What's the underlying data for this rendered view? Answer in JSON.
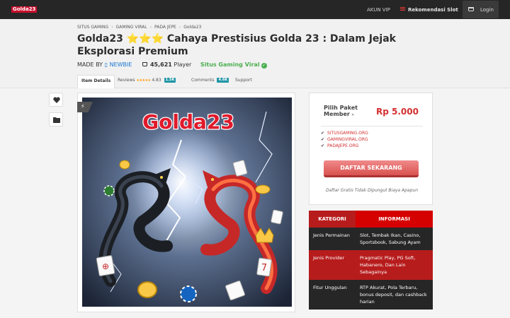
{
  "nav": {
    "logo": "Golda23",
    "akun_vip": "AKUN VIP",
    "rekomendasi": "Rekomendasi Slot",
    "login": "Login"
  },
  "breadcrumb": [
    "SITUS GAMING",
    "GAMING VIRAL",
    "PADA JEPE",
    "Golda23"
  ],
  "product": {
    "title": "Golda23 ⭐⭐⭐ Cahaya Prestisius Golda 23 : Dalam Jejak Eksplorasi Premium",
    "made_by_label": "MADE BY",
    "author": "NEWBIE",
    "player_count": "45,621",
    "player_label": "Player",
    "viral_label": "Situs Gaming Viral"
  },
  "tabs": {
    "item_details": "Item Details",
    "reviews": "Reviews",
    "rating": "4.83",
    "reviews_count": "1.5K",
    "comments": "Comments",
    "comments_count": "4.6K",
    "support": "Support"
  },
  "image": {
    "brand_text": "Golda23"
  },
  "purchase": {
    "package_label": "Pilih Paket Member",
    "price": "Rp 5.000",
    "links": [
      "SITUSGAMING.ORG",
      "GAMINGVIRAL.ORG",
      "PADAJEPE.ORG"
    ],
    "cta": "DAFTAR SEKARANG",
    "note": "Daftar Gratis Tidak Dipungut Biaya Apapun"
  },
  "info_table": {
    "headers": [
      "KATEGORI",
      "INFORMASI"
    ],
    "rows": [
      {
        "k": "Jenis Permainan",
        "v": "Slot, Tembak Ikan, Casino, Sportsbook, Sabung Ayam"
      },
      {
        "k": "Jenis Provider",
        "v": "Pragmatic Play, PG Soft, Habanero, Dan Lain Sebagainya"
      },
      {
        "k": "Fitur Unggulan",
        "v": "RTP Akurat, Pola Terbaru, bonus deposit, dan cashback harian"
      }
    ]
  },
  "colors": {
    "accent_red": "#d32f2f",
    "topbar": "#262626",
    "viral_green": "#4caf50",
    "badge_teal": "#2196a6"
  }
}
